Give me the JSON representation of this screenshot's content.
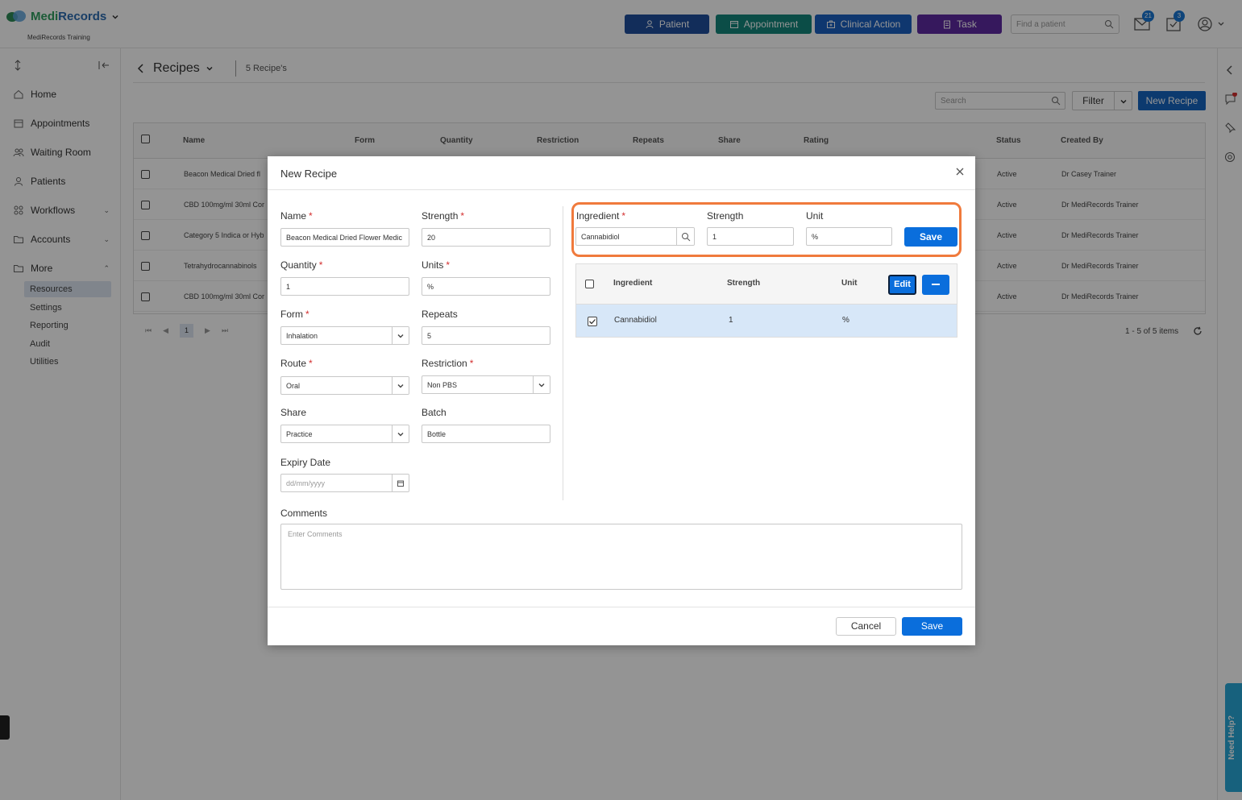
{
  "app": {
    "name_a": "Medi",
    "name_b": "Records",
    "subtitle": "MediRecords Training"
  },
  "topbar": {
    "buttons": [
      {
        "label": "Patient",
        "color": "#1f4e9c"
      },
      {
        "label": "Appointment",
        "color": "#14857b"
      },
      {
        "label": "Clinical Action",
        "color": "#1a5fc0"
      },
      {
        "label": "Task",
        "color": "#5e2aa1"
      }
    ],
    "find_placeholder": "Find a patient",
    "mail_count": "21",
    "tasks_count": "3"
  },
  "sidebar": {
    "items": [
      {
        "label": "Home",
        "icon": "home-icon"
      },
      {
        "label": "Appointments",
        "icon": "calendar-icon"
      },
      {
        "label": "Waiting Room",
        "icon": "people-icon"
      },
      {
        "label": "Patients",
        "icon": "person-icon"
      },
      {
        "label": "Workflows",
        "icon": "workflow-icon"
      },
      {
        "label": "Accounts",
        "icon": "folder-icon"
      },
      {
        "label": "More",
        "icon": "folder-icon"
      }
    ],
    "sub_items": [
      "Resources",
      "Settings",
      "Reporting",
      "Audit",
      "Utilities"
    ],
    "active_sub": "Resources"
  },
  "page": {
    "title": "Recipes",
    "count": "5 Recipe's",
    "search_placeholder": "Search",
    "filter_label": "Filter",
    "new_label": "New Recipe",
    "columns": [
      "Name",
      "Form",
      "Quantity",
      "Restriction",
      "Repeats",
      "Share",
      "Rating",
      "Status",
      "Created By"
    ],
    "rows": [
      {
        "name": "Beacon Medical Dried fl",
        "status": "Active",
        "created_by": "Dr Casey Trainer"
      },
      {
        "name": "CBD 100mg/ml 30ml Cor",
        "status": "Active",
        "created_by": "Dr MediRecords Trainer"
      },
      {
        "name": "Category 5 Indica or Hyb",
        "status": "Active",
        "created_by": "Dr MediRecords Trainer"
      },
      {
        "name": "Tetrahydrocannabinols",
        "status": "Active",
        "created_by": "Dr MediRecords Trainer"
      },
      {
        "name": "CBD 100mg/ml 30ml Cor",
        "status": "Active",
        "created_by": "Dr MediRecords Trainer"
      }
    ],
    "current_page": "1",
    "items_text": "1 - 5 of 5 items"
  },
  "help_label": "Need Help?",
  "modal": {
    "title": "New Recipe",
    "fields": {
      "name": {
        "label": "Name",
        "value": "Beacon Medical Dried Flower Medic"
      },
      "strength": {
        "label": "Strength",
        "value": "20"
      },
      "quantity": {
        "label": "Quantity",
        "value": "1"
      },
      "units": {
        "label": "Units",
        "value": "%"
      },
      "form": {
        "label": "Form",
        "value": "Inhalation"
      },
      "repeats": {
        "label": "Repeats",
        "value": "5"
      },
      "route": {
        "label": "Route",
        "value": "Oral"
      },
      "restriction": {
        "label": "Restriction",
        "value": "Non PBS"
      },
      "share": {
        "label": "Share",
        "value": "Practice"
      },
      "batch": {
        "label": "Batch",
        "value": "Bottle"
      },
      "expiry": {
        "label": "Expiry Date",
        "placeholder": "dd/mm/yyyy"
      }
    },
    "ingredient_form": {
      "ingredient_label": "Ingredient",
      "ingredient_value": "Cannabidiol",
      "strength_label": "Strength",
      "strength_value": "1",
      "unit_label": "Unit",
      "unit_value": "%",
      "save_label": "Save"
    },
    "ingredient_grid": {
      "columns": [
        "Ingredient",
        "Strength",
        "Unit"
      ],
      "edit_label": "Edit",
      "rows": [
        {
          "ingredient": "Cannabidiol",
          "strength": "1",
          "unit": "%"
        }
      ]
    },
    "comments_label": "Comments",
    "comments_placeholder": "Enter Comments",
    "cancel_label": "Cancel",
    "save_label": "Save"
  }
}
